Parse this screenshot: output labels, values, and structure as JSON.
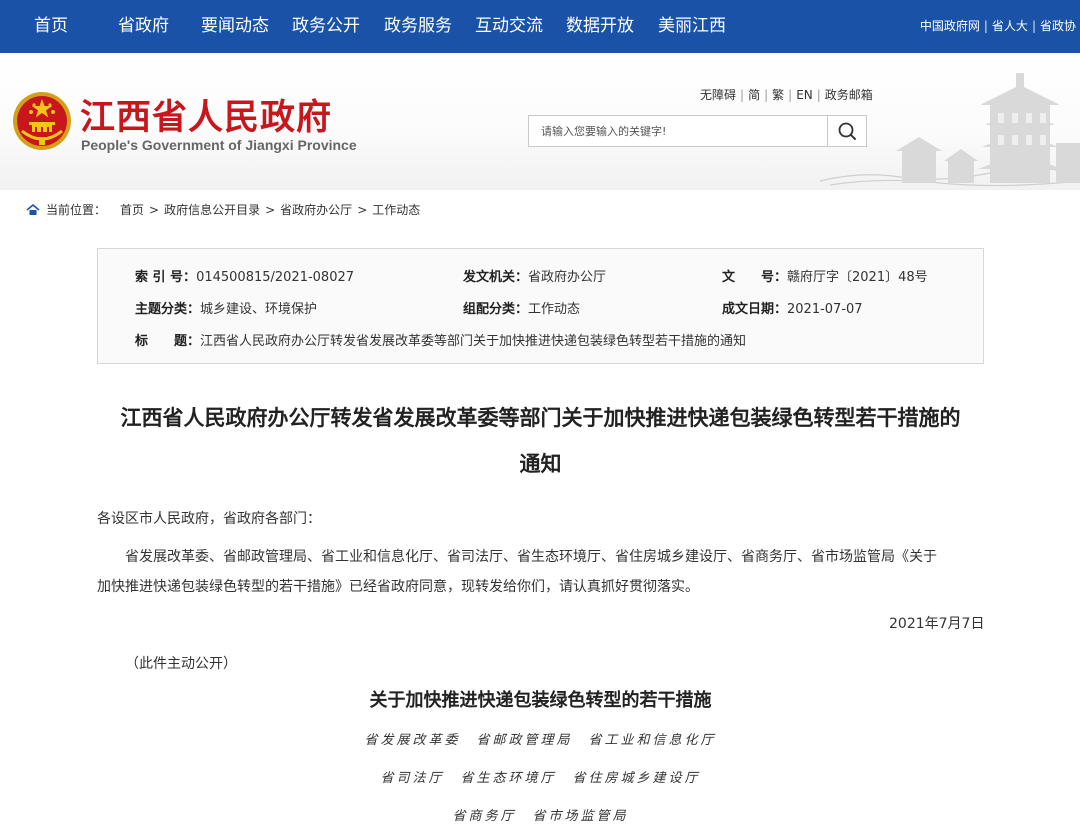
{
  "nav": {
    "items": [
      "首页",
      "省政府",
      "要闻动态",
      "政务公开",
      "政务服务",
      "互动交流",
      "数据开放",
      "美丽江西"
    ],
    "links": [
      "中国政府网",
      "省人大",
      "省政协"
    ]
  },
  "header": {
    "title": "江西省人民政府",
    "subtitle": "People's Government of Jiangxi Province",
    "util_links": [
      "无障碍",
      "简",
      "繁",
      "EN",
      "政务邮箱"
    ],
    "search_placeholder": "请输入您要输入的关键字!",
    "brand_color": "#c8161d",
    "nav_color": "#1a52a8"
  },
  "breadcrumb": {
    "label": "当前位置：",
    "items": [
      "首页",
      "政府信息公开目录",
      "省政府办公厅",
      "工作动态"
    ]
  },
  "info": {
    "index_label": "索 引 号：",
    "index_value": "014500815/2021-08027",
    "issuer_label": "发文机关：",
    "issuer_value": "省政府办公厅",
    "docno_label": "文　　号：",
    "docno_value": "赣府厅字〔2021〕48号",
    "topic_label": "主题分类：",
    "topic_value": "城乡建设、环境保护",
    "category_label": "组配分类：",
    "category_value": "工作动态",
    "date_label": "成文日期：",
    "date_value": "2021-07-07",
    "title_label": "标　　题：",
    "title_value": "江西省人民政府办公厅转发省发展改革委等部门关于加快推进快递包装绿色转型若干措施的通知"
  },
  "article": {
    "title_line1": "江西省人民政府办公厅转发省发展改革委等部门关于加快推进快递包装绿色转型若干措施的",
    "title_line2": "通知",
    "salutation": "各设区市人民政府，省政府各部门：",
    "body_line1": "省发展改革委、省邮政管理局、省工业和信息化厅、省司法厅、省生态环境厅、省住房城乡建设厅、省商务厅、省市场监管局《关于",
    "body_line2": "加快推进快递包装绿色转型的若干措施》已经省政府同意，现转发给你们，请认真抓好贯彻落实。",
    "date": "2021年7月7日",
    "disclosure": "（此件主动公开）",
    "subtitle": "关于加快推进快递包装绿色转型的若干措施",
    "agencies_line1": "省发展改革委　省邮政管理局　省工业和信息化厅",
    "agencies_line2": "省司法厅　省生态环境厅　省住房城乡建设厅",
    "agencies_line3": "省商务厅　省市场监管局"
  }
}
